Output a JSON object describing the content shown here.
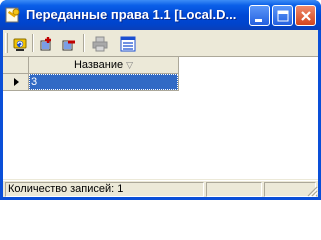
{
  "window": {
    "title": "Переданные права 1.1 [Local.D...",
    "buttons": [
      "minimize",
      "maximize",
      "close"
    ],
    "app_icon": "key-document-icon"
  },
  "toolbar": {
    "tools": [
      {
        "name": "refresh-button",
        "icon": "refresh-icon",
        "enabled": true
      },
      {
        "name": "add-button",
        "icon": "add-icon",
        "enabled": true
      },
      {
        "name": "remove-button",
        "icon": "remove-icon",
        "enabled": true
      },
      {
        "name": "print-button",
        "icon": "printer-icon",
        "enabled": false
      },
      {
        "name": "view-button",
        "icon": "table-view-icon",
        "enabled": true
      }
    ]
  },
  "grid": {
    "columns": [
      {
        "label": "Название",
        "sort": "descending"
      }
    ],
    "rows": [
      {
        "values": [
          "3"
        ],
        "selected": true,
        "current": true
      }
    ]
  },
  "statusbar": {
    "record_count_text": "Количество записей: 1",
    "panel2_text": "",
    "panel3_text": ""
  },
  "colors": {
    "title_gradient_mid": "#0048d6",
    "selection": "#316ac5",
    "face": "#ece9d8"
  }
}
